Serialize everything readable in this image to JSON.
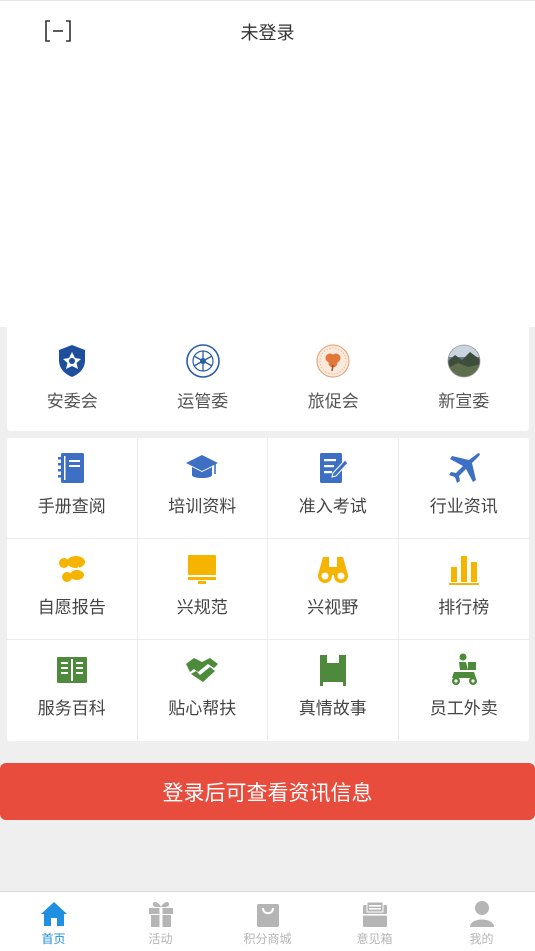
{
  "header": {
    "title": "未登录",
    "scan_icon": "scan-icon"
  },
  "committees": [
    {
      "label": "安委会",
      "icon": "safety-committee-logo"
    },
    {
      "label": "运管委",
      "icon": "operations-committee-logo"
    },
    {
      "label": "旅促会",
      "icon": "tourism-council-logo"
    },
    {
      "label": "新宣委",
      "icon": "publicity-committee-logo"
    }
  ],
  "menu": [
    {
      "label": "手册查阅",
      "icon": "manual-icon",
      "color": "#3d6fc4"
    },
    {
      "label": "培训资料",
      "icon": "graduation-cap-icon",
      "color": "#3d6fc4"
    },
    {
      "label": "准入考试",
      "icon": "exam-icon",
      "color": "#3d6fc4"
    },
    {
      "label": "行业资讯",
      "icon": "airplane-icon",
      "color": "#3d6fc4"
    },
    {
      "label": "自愿报告",
      "icon": "report-icon",
      "color": "#f5b400"
    },
    {
      "label": "兴规范",
      "icon": "monitor-icon",
      "color": "#f5b400"
    },
    {
      "label": "兴视野",
      "icon": "binoculars-icon",
      "color": "#f5b400"
    },
    {
      "label": "排行榜",
      "icon": "bar-chart-icon",
      "color": "#f5b400"
    },
    {
      "label": "服务百科",
      "icon": "book-icon",
      "color": "#4d8a3b"
    },
    {
      "label": "贴心帮扶",
      "icon": "handshake-icon",
      "color": "#4d8a3b"
    },
    {
      "label": "真情故事",
      "icon": "story-flag-icon",
      "color": "#4d8a3b"
    },
    {
      "label": "员工外卖",
      "icon": "delivery-icon",
      "color": "#4d8a3b"
    }
  ],
  "login_button": {
    "label": "登录后可查看资讯信息",
    "color": "#e84c3d"
  },
  "tabbar": [
    {
      "label": "首页",
      "icon": "home-icon",
      "active": true
    },
    {
      "label": "活动",
      "icon": "gift-icon",
      "active": false
    },
    {
      "label": "积分商城",
      "icon": "shopping-bag-icon",
      "active": false
    },
    {
      "label": "意见箱",
      "icon": "suggestion-box-icon",
      "active": false
    },
    {
      "label": "我的",
      "icon": "user-icon",
      "active": false
    }
  ],
  "colors": {
    "accent": "#1e8fe1",
    "inactive": "#b5b5b5"
  }
}
